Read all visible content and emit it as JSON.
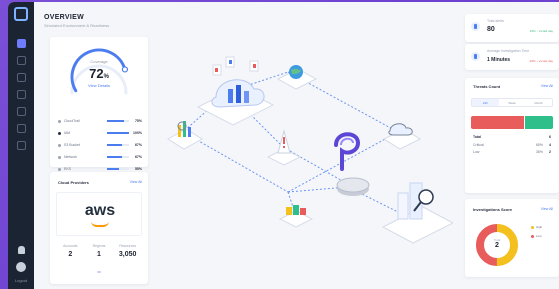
{
  "header": {
    "title": "OVERVIEW",
    "subtitle": "Simulated Environment & Readiness"
  },
  "coverage": {
    "label": "Coverage",
    "value": "72",
    "unit": "%",
    "level": 0.72,
    "link": "View Details",
    "rows": [
      {
        "name": "CloudTrail",
        "value": 0.75,
        "pct": "75%",
        "color": "#9aa3b2"
      },
      {
        "name": "IAM",
        "value": 1.0,
        "pct": "100%",
        "color": "#2b3142"
      },
      {
        "name": "S3 Bucket",
        "value": 0.67,
        "pct": "67%",
        "color": "#9aa3b2"
      },
      {
        "name": "Network",
        "value": 0.67,
        "pct": "67%",
        "color": "#9aa3b2"
      },
      {
        "name": "EKS",
        "value": 0.55,
        "pct": "55%",
        "color": "#9aa3b2"
      }
    ]
  },
  "cloud": {
    "title": "Cloud Providers",
    "link": "View All",
    "provider": "aws",
    "stats": [
      {
        "label": "Accounts",
        "value": "2"
      },
      {
        "label": "Regions",
        "value": "1"
      },
      {
        "label": "Resources",
        "value": "3,050"
      }
    ]
  },
  "stats": {
    "alerts_label": "Total alerts",
    "alerts_value": "80",
    "alerts_trend": "10% ↑ vs last day",
    "time_label": "Average Investigation Time",
    "time_value": "1 Minutes",
    "time_trend": "20% ↓ vs last day"
  },
  "threats": {
    "title": "Threats Count",
    "link": "View All",
    "tabs": [
      "24h",
      "Week",
      "Month"
    ],
    "active_tab": 0,
    "critical_share": 0.65,
    "total_label": "Total",
    "total_value": "6",
    "rows": [
      {
        "name": "Critical",
        "pct": "65%",
        "value": "4"
      },
      {
        "name": "Low",
        "pct": "35%",
        "value": "2"
      }
    ]
  },
  "investigation": {
    "title": "Investigations Score",
    "link": "View All",
    "center_label": "Total",
    "center_value": "2",
    "legend": [
      {
        "name": "High",
        "color": "#f4c01e",
        "share": 0.5
      },
      {
        "name": "Low",
        "color": "#e85c5c",
        "share": 0.5
      }
    ]
  },
  "sidebar": {
    "footer": "Logout"
  },
  "colors": {
    "accent": "#4c7df0",
    "sidebar": "#1b2433",
    "critical": "#e85c5c",
    "low": "#2fbf8a",
    "aws_orange": "#ff9900"
  }
}
